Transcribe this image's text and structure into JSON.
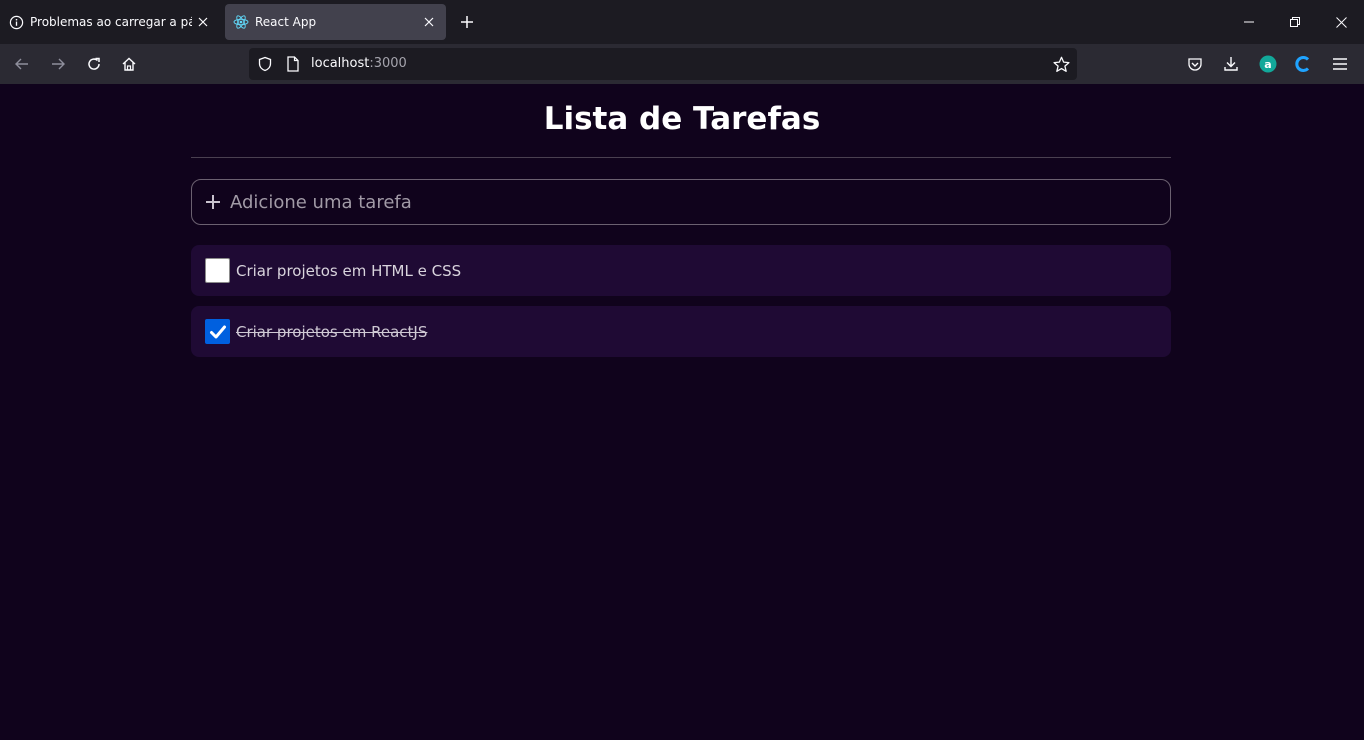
{
  "browser": {
    "tabs": [
      {
        "title": "Problemas ao carregar a página",
        "icon": "info-icon",
        "active": false
      },
      {
        "title": "React App",
        "icon": "react-icon",
        "active": true
      }
    ],
    "url": {
      "host": "localhost",
      "port": ":3000"
    },
    "colors": {
      "tabstrip": "#1c1b22",
      "navbar": "#2b2a33",
      "active_tab": "#42414d"
    }
  },
  "app": {
    "title": "Lista de Tarefas",
    "add_placeholder": "Adicione uma tarefa",
    "tasks": [
      {
        "label": "Criar projetos em HTML e CSS",
        "done": false
      },
      {
        "label": "Criar projetos em ReactJS",
        "done": true
      }
    ],
    "colors": {
      "background": "#10031c",
      "task_bg": "#1f0a34",
      "checkbox_checked": "#0060df"
    }
  }
}
